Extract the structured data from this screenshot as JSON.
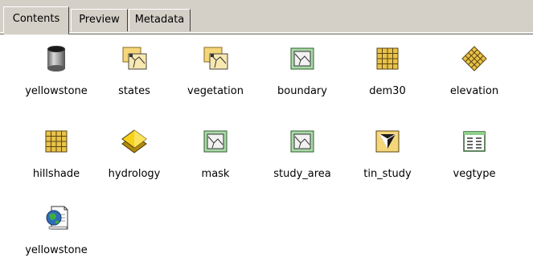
{
  "tabs": [
    {
      "label": "Contents",
      "active": true
    },
    {
      "label": "Preview",
      "active": false
    },
    {
      "label": "Metadata",
      "active": false
    }
  ],
  "items": [
    {
      "label": "yellowstone",
      "icon": "geodatabase-icon"
    },
    {
      "label": "states",
      "icon": "coverage-icon"
    },
    {
      "label": "vegetation",
      "icon": "coverage-icon"
    },
    {
      "label": "boundary",
      "icon": "shapefile-polygon-icon"
    },
    {
      "label": "dem30",
      "icon": "raster-grid-icon"
    },
    {
      "label": "elevation",
      "icon": "raster-diamond-icon"
    },
    {
      "label": "hillshade",
      "icon": "raster-grid-icon"
    },
    {
      "label": "hydrology",
      "icon": "layer-file-icon"
    },
    {
      "label": "mask",
      "icon": "shapefile-polygon-icon"
    },
    {
      "label": "study_area",
      "icon": "shapefile-polygon-icon"
    },
    {
      "label": "tin_study",
      "icon": "tin-icon"
    },
    {
      "label": "vegtype",
      "icon": "table-icon"
    },
    {
      "label": "yellowstone",
      "icon": "map-document-icon"
    }
  ],
  "colors": {
    "chrome": "#d4d0c8",
    "background": "#ffffff",
    "coverage_yellow": "#f5d77a",
    "polygon_green": "#aad9a8",
    "raster_yellow": "#e8c24a",
    "layer_yellow": "#f7d21b"
  }
}
